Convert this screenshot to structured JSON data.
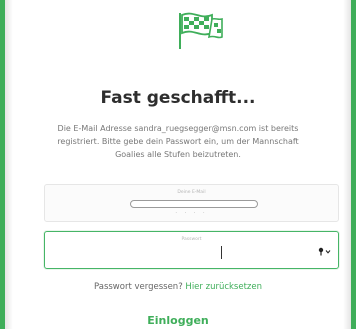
{
  "header": {
    "icon": "checkered-flag-icon",
    "title": "Fast geschafft..."
  },
  "description": "Die E-Mail Adresse sandra_ruegsegger@msn.com ist bereits registriert. Bitte gebe dein Passwort ein, um der Mannschaft Goalies alle Stufen beizutreten.",
  "email_field": {
    "label": "Deine E-Mail",
    "value": ""
  },
  "password_field": {
    "label": "Passwort",
    "value": "",
    "icon": "key-dropdown-icon"
  },
  "forgot": {
    "text": "Passwort vergessen?",
    "link": "Hier zurücksetzen"
  },
  "login_button": "Einloggen",
  "colors": {
    "accent": "#3fae5a",
    "title": "#2e2e2e",
    "body_text": "#777777"
  }
}
